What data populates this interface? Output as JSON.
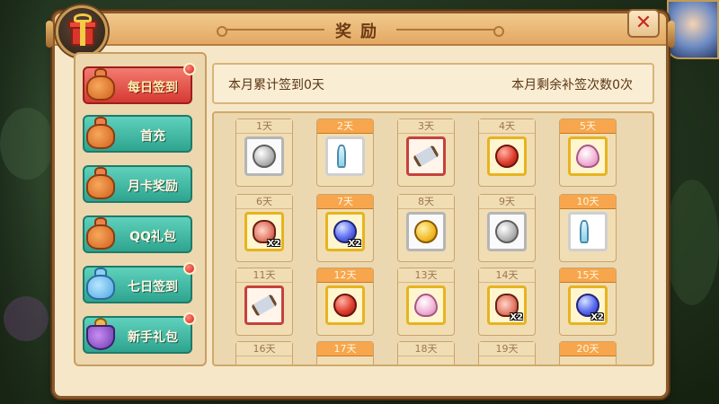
{
  "dialog": {
    "title": "奖励",
    "close_glyph": "✕"
  },
  "sidebar": {
    "items": [
      {
        "label": "每日签到",
        "icon": "money-bag-icon",
        "active": true,
        "badge": true
      },
      {
        "label": "首充",
        "icon": "money-bag-icon",
        "active": false,
        "badge": false
      },
      {
        "label": "月卡奖励",
        "icon": "money-bag-icon",
        "active": false,
        "badge": false
      },
      {
        "label": "QQ礼包",
        "icon": "money-bag-icon",
        "active": false,
        "badge": false
      },
      {
        "label": "七日签到",
        "icon": "blue-bag-icon",
        "active": false,
        "badge": true
      },
      {
        "label": "新手礼包",
        "icon": "treasure-bowl-icon",
        "active": false,
        "badge": true
      }
    ]
  },
  "info": {
    "signed_text": "本月累计签到0天",
    "makeup_text": "本月剩余补签次数0次"
  },
  "days": [
    {
      "label": "1天",
      "item": "silver-coin-icon",
      "frame": "silver",
      "qty": "",
      "label_gold": false
    },
    {
      "label": "2天",
      "item": "potion-icon",
      "frame": "white",
      "qty": "",
      "label_gold": true
    },
    {
      "label": "3天",
      "item": "scroll-icon",
      "frame": "red",
      "qty": "",
      "label_gold": false
    },
    {
      "label": "4天",
      "item": "red-orb-icon",
      "frame": "gold",
      "qty": "",
      "label_gold": false
    },
    {
      "label": "5天",
      "item": "egg-icon",
      "frame": "gold",
      "qty": "",
      "label_gold": true
    },
    {
      "label": "6天",
      "item": "pet-icon",
      "frame": "gold",
      "qty": "X2",
      "label_gold": false
    },
    {
      "label": "7天",
      "item": "blue-orb-icon",
      "frame": "gold",
      "qty": "X2",
      "label_gold": true
    },
    {
      "label": "8天",
      "item": "gold-coin-icon",
      "frame": "silver",
      "qty": "",
      "label_gold": false
    },
    {
      "label": "9天",
      "item": "silver-coin-icon",
      "frame": "silver",
      "qty": "",
      "label_gold": false
    },
    {
      "label": "10天",
      "item": "potion-icon",
      "frame": "white",
      "qty": "",
      "label_gold": true
    },
    {
      "label": "11天",
      "item": "scroll-icon",
      "frame": "red",
      "qty": "",
      "label_gold": false
    },
    {
      "label": "12天",
      "item": "red-orb-icon",
      "frame": "gold",
      "qty": "",
      "label_gold": true
    },
    {
      "label": "13天",
      "item": "egg-icon",
      "frame": "gold",
      "qty": "",
      "label_gold": false
    },
    {
      "label": "14天",
      "item": "pet-icon",
      "frame": "gold",
      "qty": "X2",
      "label_gold": false
    },
    {
      "label": "15天",
      "item": "blue-orb-icon",
      "frame": "gold",
      "qty": "X2",
      "label_gold": true
    },
    {
      "label": "16天",
      "item": "",
      "frame": "",
      "qty": "",
      "label_gold": false
    },
    {
      "label": "17天",
      "item": "",
      "frame": "",
      "qty": "",
      "label_gold": true
    },
    {
      "label": "18天",
      "item": "",
      "frame": "",
      "qty": "",
      "label_gold": false
    },
    {
      "label": "19天",
      "item": "",
      "frame": "",
      "qty": "",
      "label_gold": false
    },
    {
      "label": "20天",
      "item": "",
      "frame": "",
      "qty": "",
      "label_gold": true
    }
  ],
  "colors": {
    "active_tab": "#d53a33",
    "tab": "#2ea48f",
    "day_label_gold": "#f7a64d"
  }
}
